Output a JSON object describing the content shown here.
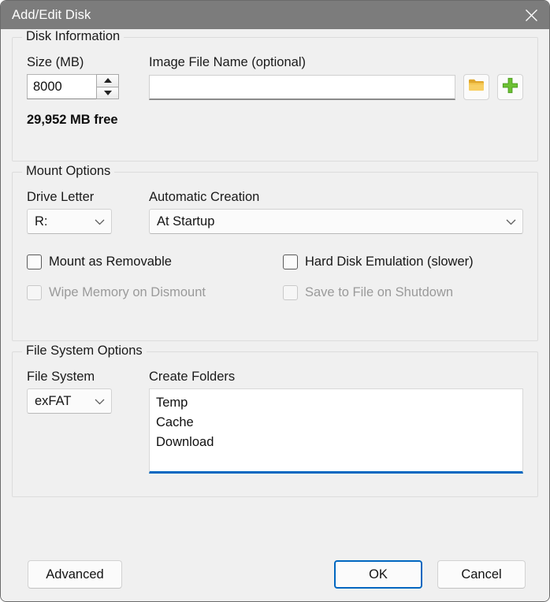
{
  "window": {
    "title": "Add/Edit Disk",
    "close_icon": "close-icon"
  },
  "disk_information": {
    "legend": "Disk Information",
    "size_label": "Size (MB)",
    "size_value": "8000",
    "size_spin_up_icon": "spinner-up-icon",
    "size_spin_down_icon": "spinner-down-icon",
    "free_space": "29,952 MB free",
    "image_file_label": "Image File Name (optional)",
    "image_file_value": "",
    "image_file_placeholder": "",
    "browse_icon": "folder-icon",
    "add_icon": "plus-icon"
  },
  "mount_options": {
    "legend": "Mount Options",
    "drive_letter_label": "Drive Letter",
    "drive_letter_value": "R:",
    "automatic_creation_label": "Automatic Creation",
    "automatic_creation_value": "At Startup",
    "dropdown_icon": "chevron-down-icon",
    "checkboxes": [
      {
        "label": "Mount as Removable",
        "checked": false,
        "enabled": true
      },
      {
        "label": "Hard Disk Emulation (slower)",
        "checked": false,
        "enabled": true
      },
      {
        "label": "Wipe Memory on Dismount",
        "checked": false,
        "enabled": false
      },
      {
        "label": "Save to File on Shutdown",
        "checked": false,
        "enabled": false
      }
    ]
  },
  "file_system_options": {
    "legend": "File System Options",
    "file_system_label": "File System",
    "file_system_value": "exFAT",
    "create_folders_label": "Create Folders",
    "create_folders_value": "Temp\nCache\nDownload",
    "create_folders_lines": [
      "Temp",
      "Cache",
      "Download"
    ]
  },
  "footer": {
    "advanced_label": "Advanced",
    "ok_label": "OK",
    "cancel_label": "Cancel"
  },
  "colors": {
    "accent": "#0067C0",
    "titlebar": "#7C7C7C",
    "dialog_background": "#F0F0F0",
    "folder_icon": "#F2C14B",
    "plus_icon": "#5CB226"
  }
}
